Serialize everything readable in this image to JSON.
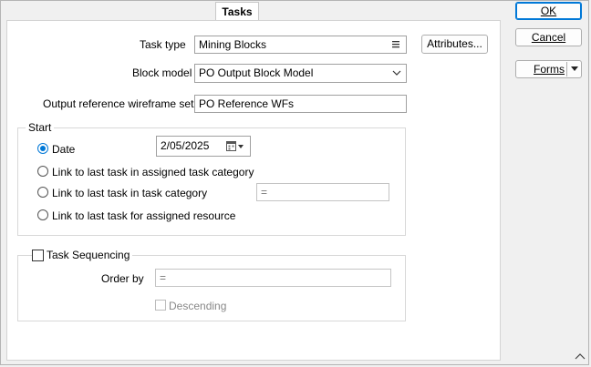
{
  "tab": {
    "label": "Tasks"
  },
  "buttons": {
    "ok": "OK",
    "cancel": "Cancel",
    "forms": "Forms",
    "attributes": "Attributes..."
  },
  "form": {
    "task_type_label": "Task type",
    "task_type_value": "Mining Blocks",
    "block_model_label": "Block model",
    "block_model_value": "PO Output Block Model",
    "output_ref_label": "Output reference wireframe set",
    "output_ref_value": "PO Reference WFs"
  },
  "start": {
    "title": "Start",
    "date_label": "Date",
    "date_value": "2/05/2025",
    "opt_assigned_category": "Link to last task in assigned task category",
    "opt_task_category": "Link to last task in task category",
    "task_category_value": "=",
    "opt_assigned_resource": "Link to last task for assigned resource",
    "selected": "Date"
  },
  "sequencing": {
    "title": "Task Sequencing",
    "checked": false,
    "order_by_label": "Order by",
    "order_by_value": "=",
    "descending_label": "Descending",
    "descending_checked": false
  }
}
